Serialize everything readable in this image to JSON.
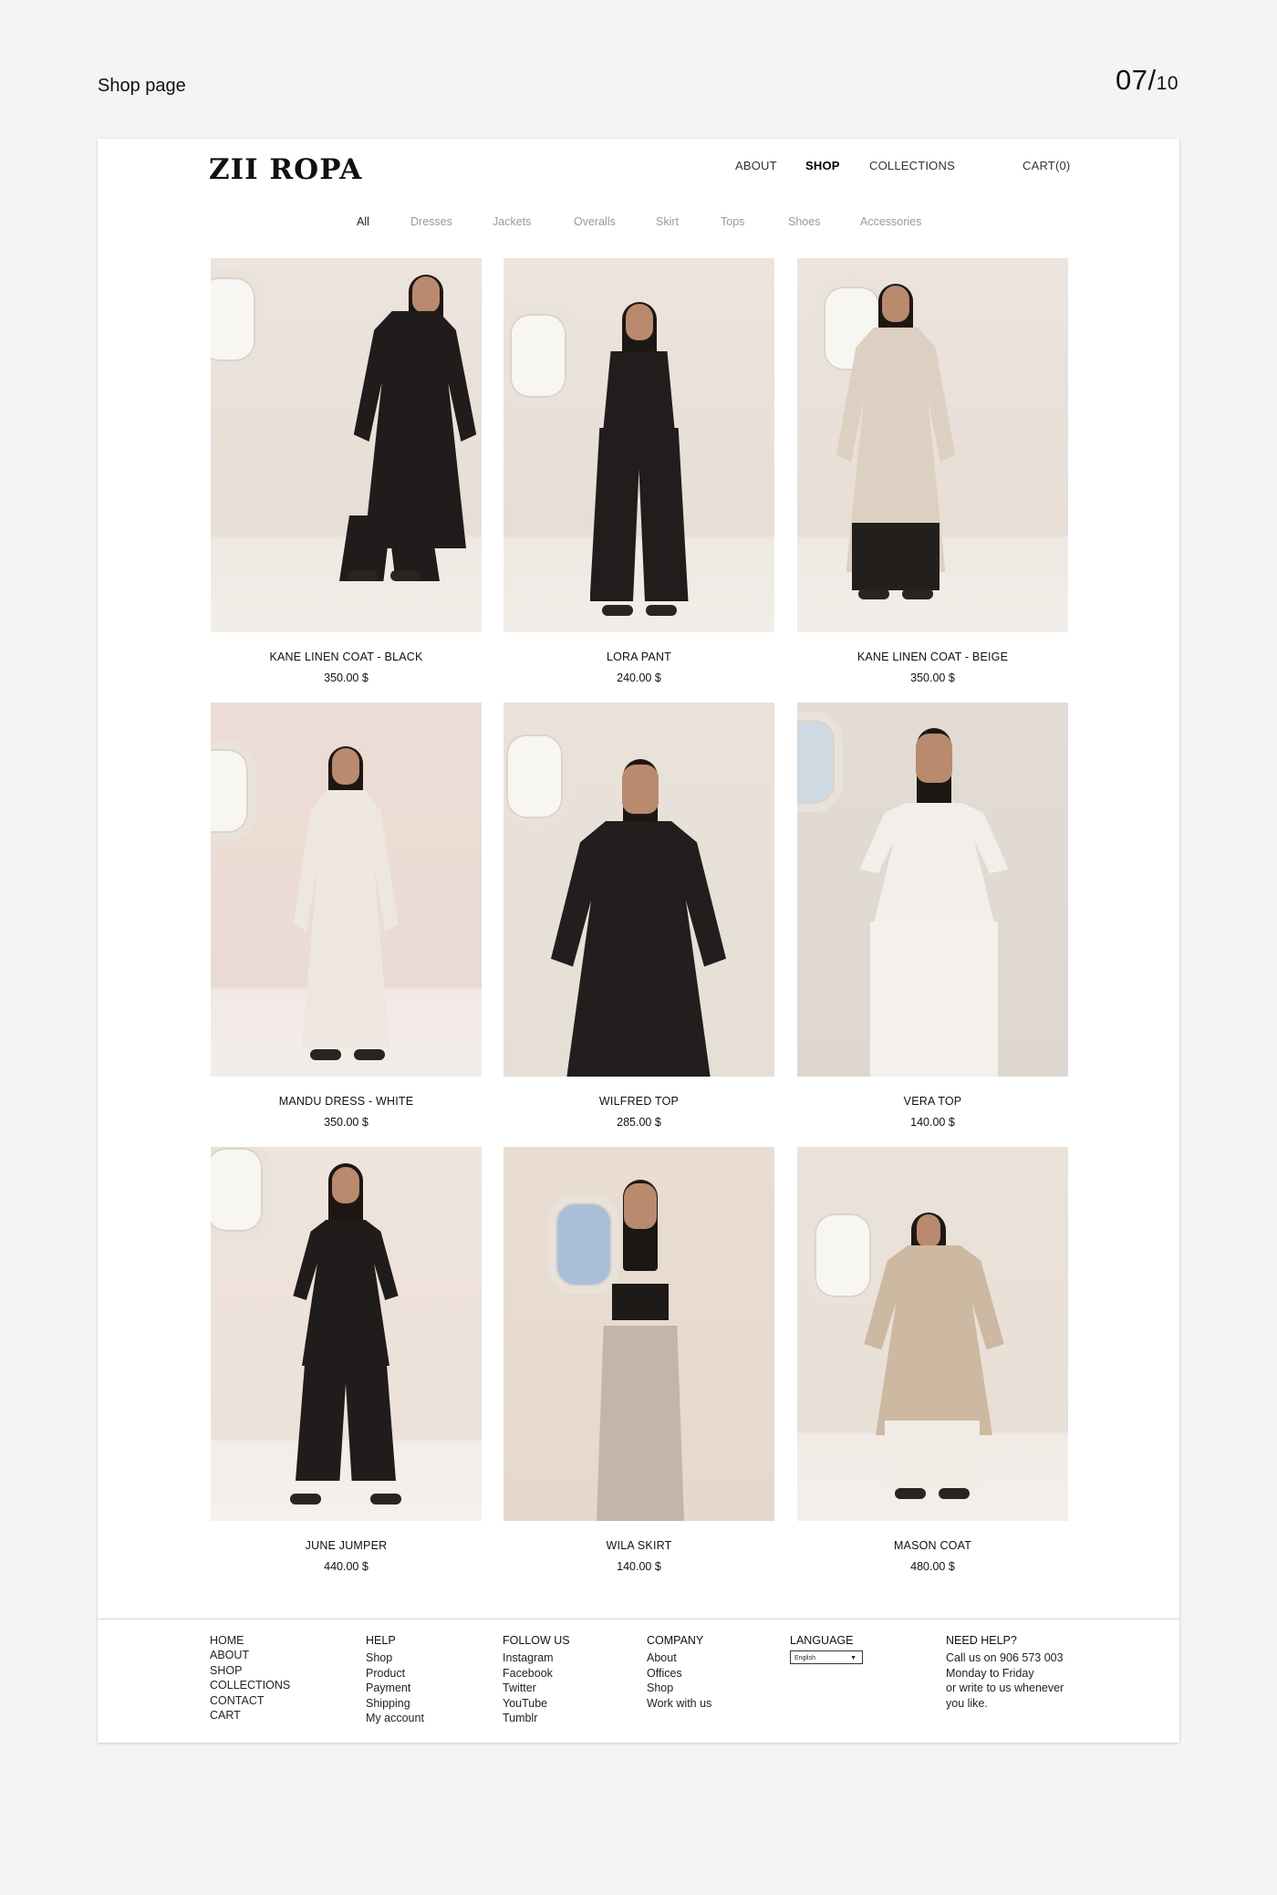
{
  "deck": {
    "title": "Shop page",
    "page_current": "07/",
    "page_total": "10"
  },
  "brand": {
    "logo": "ZII ROPA"
  },
  "nav": {
    "about": "ABOUT",
    "shop": "SHOP",
    "collections": "COLLECTIONS",
    "cart": "CART(0)"
  },
  "categories": [
    "All",
    "Dresses",
    "Jackets",
    "Overalls",
    "Skirt",
    "Tops",
    "Shoes",
    "Accessories"
  ],
  "active_category": "All",
  "products": [
    {
      "name": "KANE LINEN COAT - BLACK",
      "price": "350.00 $"
    },
    {
      "name": "LORA PANT",
      "price": "240.00 $"
    },
    {
      "name": "KANE LINEN COAT - BEIGE",
      "price": "350.00 $"
    },
    {
      "name": "MANDU DRESS - WHITE",
      "price": "350.00 $"
    },
    {
      "name": "WILFRED TOP",
      "price": "285.00 $"
    },
    {
      "name": "VERA TOP",
      "price": "140.00 $"
    },
    {
      "name": "JUNE JUMPER",
      "price": "440.00 $"
    },
    {
      "name": "WILA SKIRT",
      "price": "140.00 $"
    },
    {
      "name": "MASON COAT",
      "price": "480.00 $"
    }
  ],
  "footer": {
    "main_links": [
      "HOME",
      "ABOUT",
      "SHOP",
      "COLLECTIONS",
      "CONTACT",
      "CART"
    ],
    "help": {
      "heading": "HELP",
      "links": [
        "Shop",
        "Product",
        "Payment",
        "Shipping",
        "My account"
      ]
    },
    "follow": {
      "heading": "FOLLOW US",
      "links": [
        "Instagram",
        "Facebook",
        "Twitter",
        "YouTube",
        "Tumblr"
      ]
    },
    "company": {
      "heading": "COMPANY",
      "links": [
        "About",
        "Offices",
        "Shop",
        "Work with us"
      ]
    },
    "language": {
      "heading": "LANGUAGE",
      "selected": "English",
      "arrow": "▼"
    },
    "need_help": {
      "heading": "NEED HELP?",
      "lines": [
        "Call us on 906 573 003",
        "Monday to Friday",
        "or write to us whenever",
        "you like."
      ]
    }
  },
  "colors": {
    "background": "#f4f4f4",
    "panel": "#ffffff",
    "text": "#111111",
    "muted": "#9a9a9a",
    "photo_wall": "#ece4dd"
  }
}
